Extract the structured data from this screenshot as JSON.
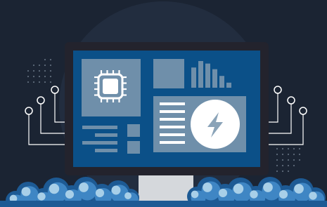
{
  "illustration": {
    "subject": "computer-monitor-dashboard",
    "colors": {
      "background": "#1b2433",
      "halo": "#222d3f",
      "monitor_frame": "#23232d",
      "screen": "#0b5088",
      "panel": "#6f8faa",
      "panel_light": "#8aa3b8",
      "white": "#ffffff",
      "stand": "#d5d8dc",
      "circuit_line": "#ffffff",
      "dots": "#5f6b7b",
      "cloud_dark": "#1d5a94",
      "cloud_mid": "#3f86c4",
      "cloud_light": "#a8cfe8"
    },
    "icons": {
      "chip": "cpu-chip-icon",
      "bolt": "lightning-bolt-icon"
    },
    "bar_chart_levels": [
      0.72,
      0.95,
      0.86,
      0.66,
      0.42,
      0.18
    ]
  }
}
